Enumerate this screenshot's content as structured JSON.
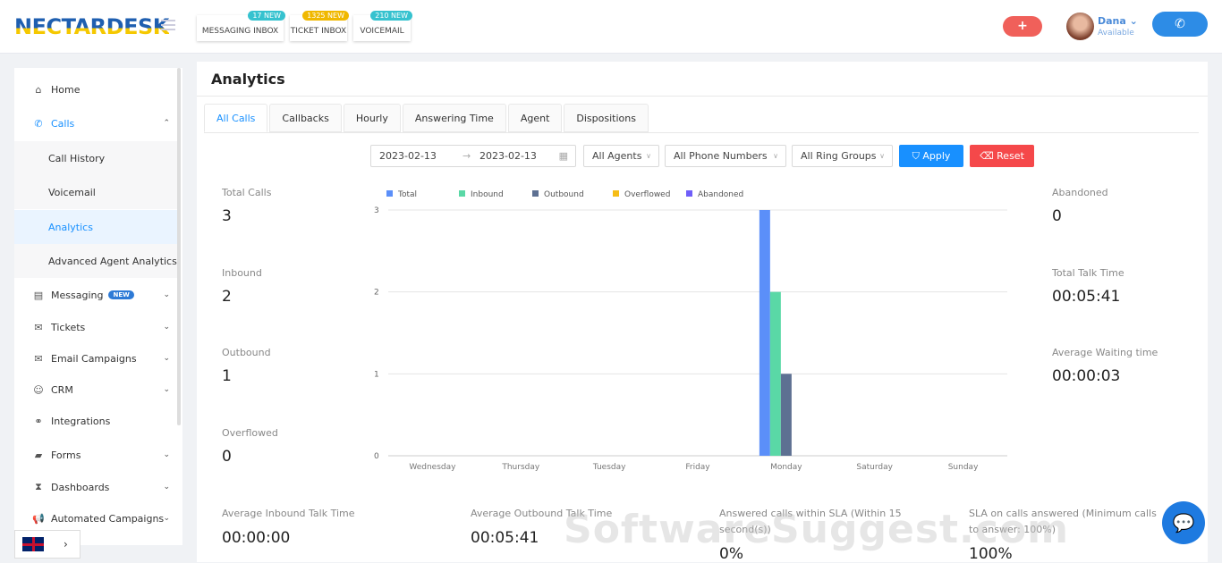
{
  "header": {
    "logo": "NECTARDESK",
    "inboxes": [
      {
        "label": "MESSAGING INBOX",
        "badge": "17 NEW",
        "color": "#36c2cf"
      },
      {
        "label": "TICKET INBOX",
        "badge": "1325 NEW",
        "color": "#f0b800"
      },
      {
        "label": "VOICEMAIL",
        "badge": "210 NEW",
        "color": "#36c2cf"
      }
    ],
    "plus": "+",
    "user": {
      "name": "Dana",
      "status": "Available"
    },
    "phone": "✆"
  },
  "sidebar": {
    "items": [
      {
        "label": "Home",
        "icon": "⌂"
      },
      {
        "label": "Calls",
        "icon": "✆"
      },
      {
        "label": "Call History"
      },
      {
        "label": "Voicemail"
      },
      {
        "label": "Analytics"
      },
      {
        "label": "Advanced Agent Analytics"
      },
      {
        "label": "Messaging",
        "icon": "▤",
        "badge": "NEW"
      },
      {
        "label": "Tickets",
        "icon": "✉"
      },
      {
        "label": "Email Campaigns",
        "icon": "✉"
      },
      {
        "label": "CRM",
        "icon": "☺"
      },
      {
        "label": "Integrations",
        "icon": "⚭"
      },
      {
        "label": "Forms",
        "icon": "▰"
      },
      {
        "label": "Dashboards",
        "icon": "⧗"
      },
      {
        "label": "Automated Campaigns",
        "icon": "📢"
      }
    ]
  },
  "page": {
    "title": "Analytics",
    "tabs": [
      "All Calls",
      "Callbacks",
      "Hourly",
      "Answering Time",
      "Agent",
      "Dispositions"
    ],
    "filters": {
      "date_from": "2023-02-13",
      "date_to": "2023-02-13",
      "agents": "All Agents",
      "phones": "All Phone Numbers",
      "ring_groups": "All Ring Groups",
      "apply": "Apply",
      "reset": "Reset"
    },
    "left_stats": [
      {
        "label": "Total Calls",
        "value": "3"
      },
      {
        "label": "Inbound",
        "value": "2"
      },
      {
        "label": "Outbound",
        "value": "1"
      },
      {
        "label": "Overflowed",
        "value": "0"
      }
    ],
    "right_stats": [
      {
        "label": "Abandoned",
        "value": "0"
      },
      {
        "label": "Total Talk Time",
        "value": "00:05:41"
      },
      {
        "label": "Average Waiting time",
        "value": "00:00:03"
      }
    ],
    "bottom_stats": [
      {
        "label": "Average Inbound Talk Time",
        "value": "00:00:00"
      },
      {
        "label": "Average Outbound Talk Time",
        "value": "00:05:41"
      },
      {
        "label": "Answered calls within SLA (Within 15 second(s))",
        "value": "0%"
      },
      {
        "label": "SLA on calls answered (Minimum calls to answer: 100%)",
        "value": "100%"
      }
    ]
  },
  "watermark": "SoftwareSuggest.com",
  "chart_data": {
    "type": "bar",
    "categories": [
      "Wednesday",
      "Thursday",
      "Tuesday",
      "Friday",
      "Monday",
      "Saturday",
      "Sunday"
    ],
    "series": [
      {
        "name": "Total",
        "color": "#5b8ff9",
        "values": [
          0,
          0,
          0,
          0,
          3,
          0,
          0
        ]
      },
      {
        "name": "Inbound",
        "color": "#5ad8a6",
        "values": [
          0,
          0,
          0,
          0,
          2,
          0,
          0
        ]
      },
      {
        "name": "Outbound",
        "color": "#5d7092",
        "values": [
          0,
          0,
          0,
          0,
          1,
          0,
          0
        ]
      },
      {
        "name": "Overflowed",
        "color": "#f6bd16",
        "values": [
          0,
          0,
          0,
          0,
          0,
          0,
          0
        ]
      },
      {
        "name": "Abandoned",
        "color": "#6f5ef9",
        "values": [
          0,
          0,
          0,
          0,
          0,
          0,
          0
        ]
      }
    ],
    "yticks": [
      "0",
      "1",
      "2",
      "3"
    ],
    "ylim": [
      0,
      3
    ],
    "legend": "top-left",
    "grid": true
  }
}
